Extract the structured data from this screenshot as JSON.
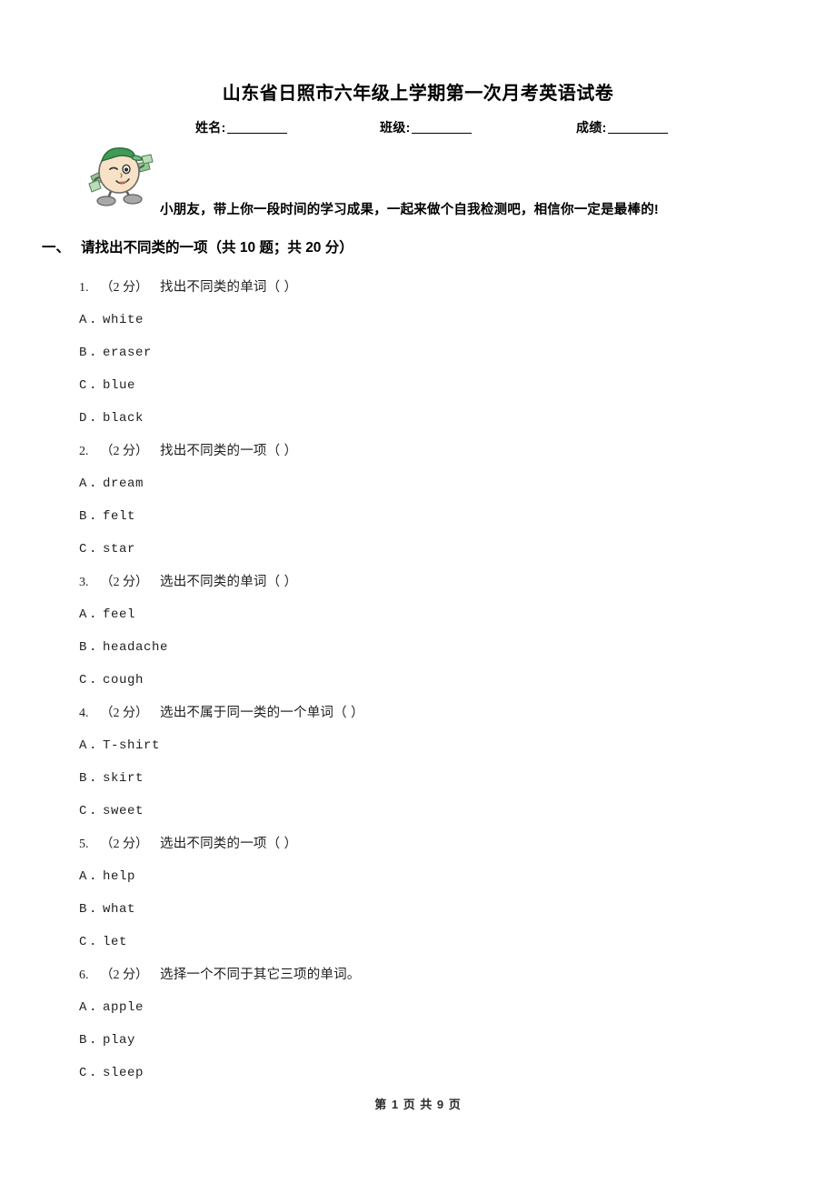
{
  "document": {
    "title": "山东省日照市六年级上学期第一次月考英语试卷",
    "info_fields": [
      {
        "label": "姓名:",
        "value": ""
      },
      {
        "label": "班级:",
        "value": ""
      },
      {
        "label": "成绩:",
        "value": ""
      }
    ],
    "mascot": {
      "name": "cartoon-student-mascot",
      "colors": {
        "cap": "#2e8b45",
        "face": "#f5dcc0",
        "outline": "#4a4a4a",
        "shoes": "#9a9a9a",
        "leaf": "#5aa05a"
      }
    },
    "intro_text": "小朋友，带上你一段时间的学习成果，一起来做个自我检测吧，相信你一定是最棒的!",
    "section": {
      "number": "一、",
      "title": "请找出不同类的一项",
      "meta": "（共 10 题；共 20 分）"
    },
    "questions": [
      {
        "index": "1.",
        "score": "（2 分）",
        "text": "找出不同类的单词（        ）",
        "options": [
          {
            "key": "A",
            "dot": ".",
            "text": "white"
          },
          {
            "key": "B",
            "dot": ".",
            "text": "eraser"
          },
          {
            "key": "C",
            "dot": ".",
            "text": "blue"
          },
          {
            "key": "D",
            "dot": ".",
            "text": "black"
          }
        ]
      },
      {
        "index": "2.",
        "score": "（2 分）",
        "text": "找出不同类的一项（        ）",
        "options": [
          {
            "key": "A",
            "dot": ".",
            "text": "dream"
          },
          {
            "key": "B",
            "dot": ".",
            "text": "felt"
          },
          {
            "key": "C",
            "dot": ".",
            "text": "star"
          }
        ]
      },
      {
        "index": "3.",
        "score": "（2 分）",
        "text": "选出不同类的单词（        ）",
        "options": [
          {
            "key": "A",
            "dot": ".",
            "text": "feel"
          },
          {
            "key": "B",
            "dot": ".",
            "text": "headache"
          },
          {
            "key": "C",
            "dot": ".",
            "text": "cough"
          }
        ]
      },
      {
        "index": "4.",
        "score": "（2 分）",
        "text": "选出不属于同一类的一个单词（        ）",
        "options": [
          {
            "key": "A",
            "dot": ".",
            "text": "T-shirt"
          },
          {
            "key": "B",
            "dot": ".",
            "text": "skirt"
          },
          {
            "key": "C",
            "dot": ".",
            "text": "sweet"
          }
        ]
      },
      {
        "index": "5.",
        "score": "（2 分）",
        "text": "选出不同类的一项（        ）",
        "options": [
          {
            "key": "A",
            "dot": ".",
            "text": "help"
          },
          {
            "key": "B",
            "dot": ".",
            "text": "what"
          },
          {
            "key": "C",
            "dot": ".",
            "text": "let"
          }
        ]
      },
      {
        "index": "6.",
        "score": "（2 分）",
        "text": "选择一个不同于其它三项的单词。",
        "options": [
          {
            "key": "A",
            "dot": ".",
            "text": "apple"
          },
          {
            "key": "B",
            "dot": ".",
            "text": "play"
          },
          {
            "key": "C",
            "dot": ".",
            "text": "sleep"
          }
        ]
      }
    ],
    "footer": "第 1 页 共 9 页"
  }
}
